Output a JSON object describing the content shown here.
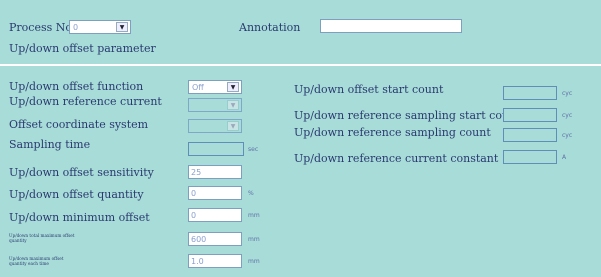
{
  "header": {
    "process_no_label": "Process No.",
    "process_no_value": "0",
    "annotation_label": "Annotation",
    "annotation_value": ""
  },
  "section_title": "Up/down offset parameter",
  "left_params": {
    "offset_function": {
      "label": "Up/down offset function",
      "value": "Off"
    },
    "reference_current": {
      "label": "Up/down reference current",
      "value": ""
    },
    "coordinate_system": {
      "label": "Offset coordinate system",
      "value": ""
    },
    "sampling_time": {
      "label": "Sampling time",
      "value": "",
      "unit": "sec"
    },
    "sensitivity": {
      "label": "Up/down offset sensitivity",
      "value": "25"
    },
    "quantity": {
      "label": "Up/down offset quantity",
      "value": "0",
      "unit": "%"
    },
    "minimum_offset": {
      "label": "Up/down minimum offset",
      "value": "0",
      "unit": "mm"
    },
    "total_maximum": {
      "label": "Up/down total maximum offset quantity",
      "value": "600",
      "unit": "mm"
    },
    "maximum_each": {
      "label": "Up/down maximum offset quantity each time",
      "value": "1.0",
      "unit": "mm"
    }
  },
  "right_params": {
    "start_count": {
      "label": "Up/down offset start count",
      "value": "",
      "unit": "cyc"
    },
    "sampling_start": {
      "label": "Up/down reference sampling start coun",
      "value": "",
      "unit": "cyc"
    },
    "sampling_count": {
      "label": "Up/down reference sampling count",
      "value": "",
      "unit": "cyc"
    },
    "current_constant": {
      "label": "Up/down reference current constant",
      "value": "",
      "unit": "A"
    }
  }
}
